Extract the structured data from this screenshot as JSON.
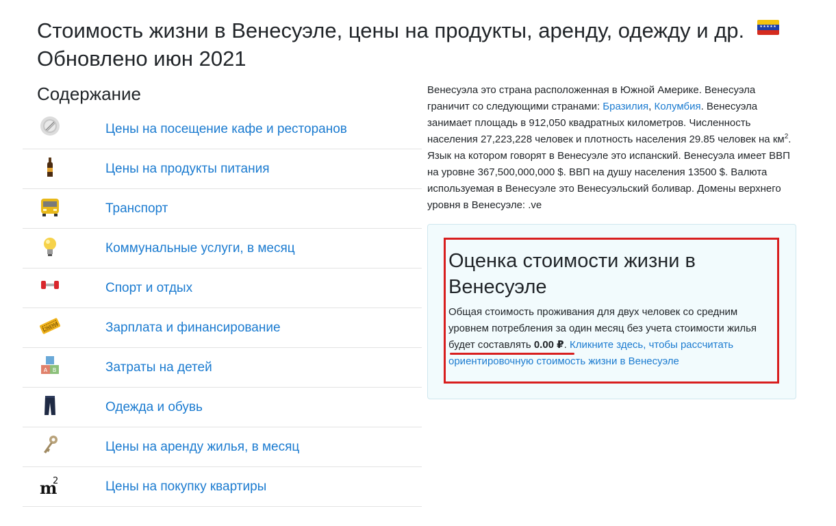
{
  "page": {
    "title_line1": "Стоимость жизни в Венесуэле, цены на продукты, аренду, одежду и др.",
    "title_line2": "Обновлено июн 2021"
  },
  "toc": {
    "heading": "Содержание",
    "items": [
      {
        "label": "Цены на посещение кафе и ресторанов",
        "icon": "plate-icon"
      },
      {
        "label": "Цены на продукты питания",
        "icon": "bottle-icon"
      },
      {
        "label": "Транспорт",
        "icon": "bus-icon"
      },
      {
        "label": "Коммунальные услуги, в месяц",
        "icon": "light-bulb-icon"
      },
      {
        "label": "Спорт и отдых",
        "icon": "dumbbell-icon"
      },
      {
        "label": "Зарплата и финансирование",
        "icon": "cinema-ticket-icon"
      },
      {
        "label": "Затраты на детей",
        "icon": "toy-blocks-icon"
      },
      {
        "label": "Одежда и обувь",
        "icon": "jeans-icon"
      },
      {
        "label": "Цены на аренду жилья, в месяц",
        "icon": "key-icon"
      },
      {
        "label": "Цены на покупку квартиры",
        "icon": "square-meter-icon"
      }
    ]
  },
  "intro": {
    "text_before_links": "Венесуэла это страна расположенная в Южной Америке. Венесуэла граничит со следующими странами: ",
    "link1": "Бразилия",
    "separator": ", ",
    "link2": "Колумбия",
    "text_after_links": ". Венесуэла занимает площадь в 912,050 квадратных километров. Численность населения 27,223,228 человек и плотность населения 29.85 человек на км",
    "superscript": "2",
    "text_end": ". Язык на котором говорят в Венесуэле это испанский. Венесуэла имеет ВВП на уровне 367,500,000,000 $. ВВП на душу населения 13500 $. Валюта используемая в Венесуэле это Венесуэльский боливар. Домены верхнего уровня в Венесуэле: .ve"
  },
  "estimate": {
    "title": "Оценка стоимости жизни в Венесуэле",
    "text": "Общая стоимость проживания для двух человек со средним уровнем потребления за один месяц без учета стоимости жилья будет составлять ",
    "amount": "0.00 ₽",
    "period": ".",
    "link": "Кликните здесь, чтобы рассчитать ориентировочную стоимость жизни в Венесуэле"
  },
  "colors": {
    "link": "#1b7bd0",
    "highlight": "#d81e1e",
    "box_bg": "#f2fbfd"
  }
}
